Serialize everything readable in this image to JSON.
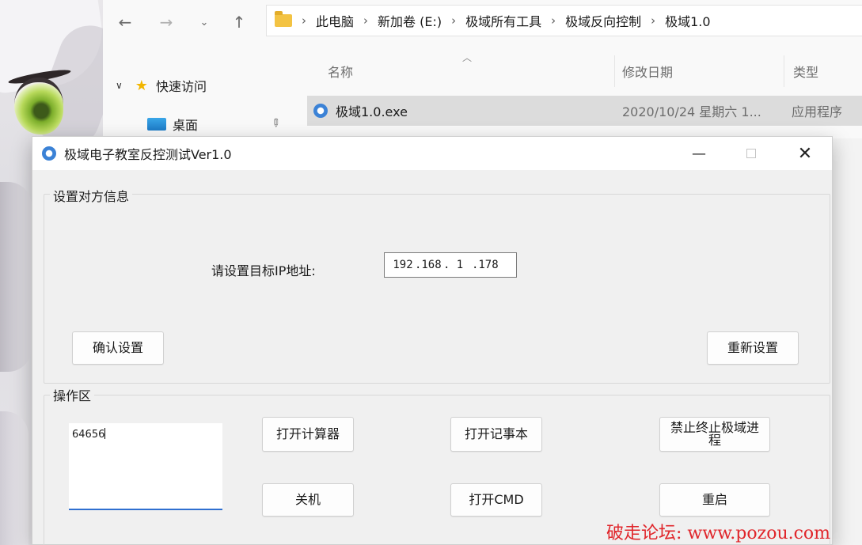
{
  "explorer": {
    "breadcrumb": [
      "此电脑",
      "新加卷 (E:)",
      "极域所有工具",
      "极域反向控制",
      "极域1.0"
    ],
    "sidebar": {
      "quick_access": "快速访问",
      "desktop": "桌面"
    },
    "columns": {
      "name": "名称",
      "modified": "修改日期",
      "type": "类型"
    },
    "file": {
      "name": "极域1.0.exe",
      "modified": "2020/10/24 星期六 1...",
      "type": "应用程序"
    }
  },
  "dialog": {
    "title": "极域电子教室反控测试Ver1.0",
    "settings_group": "设置对方信息",
    "ip_label": "请设置目标IP地址:",
    "ip": [
      "192",
      "168",
      "1",
      "178"
    ],
    "confirm_button": "确认设置",
    "reset_button": "重新设置",
    "ops_group": "操作区",
    "input_value": "64656",
    "buttons": {
      "calculator": "打开计算器",
      "notepad": "打开记事本",
      "kill_process": "禁止终止极域进程",
      "shutdown": "关机",
      "cmd": "打开CMD",
      "restart": "重启"
    }
  },
  "watermark": "破走论坛: www.pozou.com",
  "colors": {
    "accent": "#2f6fd0",
    "selection": "#dcdcdc",
    "folder": "#f3c343",
    "watermark": "#e0262b"
  }
}
